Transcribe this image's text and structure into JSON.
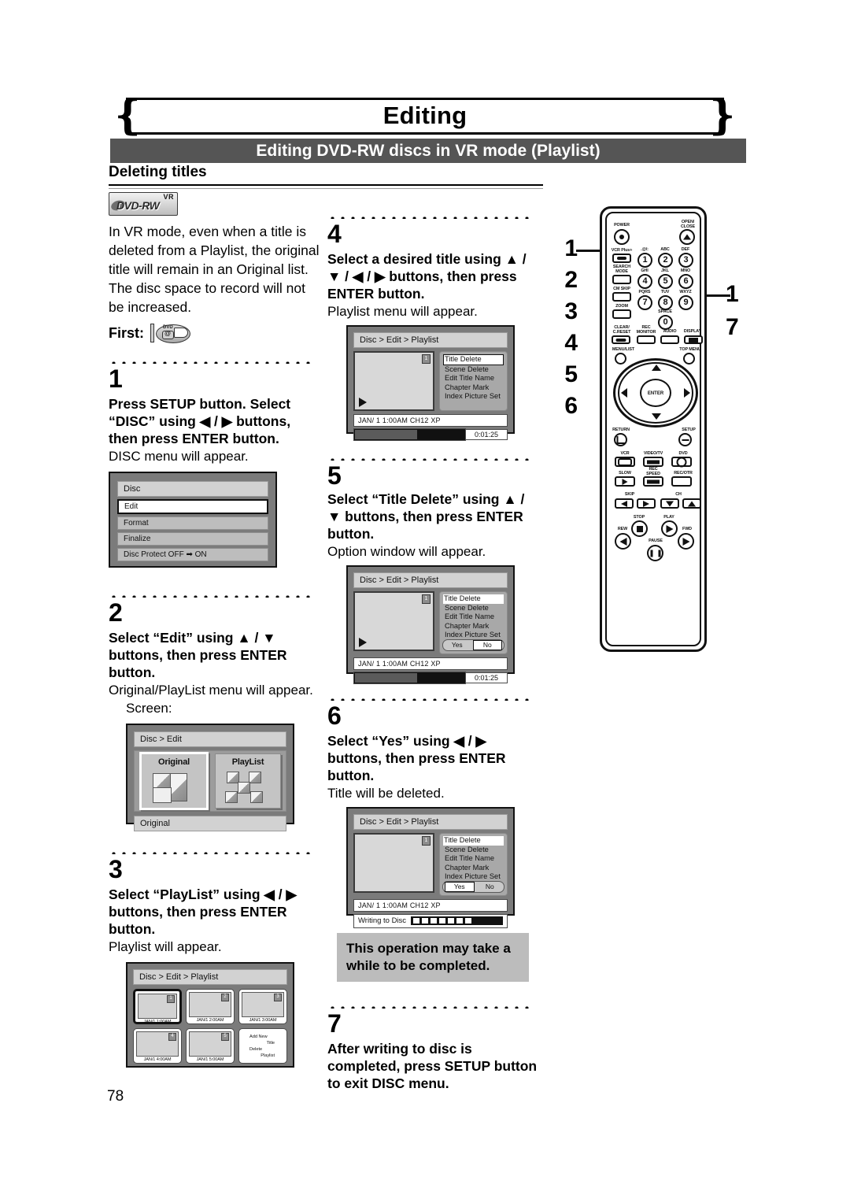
{
  "header": {
    "chapter_title": "Editing",
    "section_title": "Editing DVD-RW discs in VR mode (Playlist)",
    "subsection_title": "Deleting titles"
  },
  "left_column": {
    "badge": {
      "vr": "VR",
      "format": "DVD-RW"
    },
    "intro": "In VR mode, even when a title is deleted from a Playlist, the original title will remain in an Original list. The disc space to record will not be increased.",
    "first_label": "First:",
    "first_icon_label": "DVD",
    "steps": [
      {
        "number": "1",
        "heading": "Press SETUP button. Select “DISC” using ◀ / ▶ buttons, then press ENTER button.",
        "subtext": "DISC menu will appear.",
        "screen": {
          "title": "Disc",
          "items": [
            "Edit",
            "Format",
            "Finalize",
            "Disc Protect OFF ➡ ON"
          ],
          "selected": "Edit"
        }
      },
      {
        "number": "2",
        "heading": "Select “Edit” using ▲ / ▼ buttons, then press ENTER button.",
        "subtext": "Original/PlayList menu will appear.",
        "screen_label": "Screen:",
        "screen": {
          "title": "Disc > Edit",
          "tiles": [
            "Original",
            "PlayList"
          ],
          "selected": "Original",
          "status": "Original"
        }
      },
      {
        "number": "3",
        "heading": "Select “PlayList” using ◀ / ▶ buttons, then press ENTER button.",
        "subtext": "Playlist will appear.",
        "screen": {
          "title": "Disc > Edit > Playlist",
          "cells": [
            {
              "no": "1",
              "caption": "JAN/1  1:00AM",
              "selected": true
            },
            {
              "no": "2",
              "caption": "JAN/1  2:00AM",
              "selected": false
            },
            {
              "no": "3",
              "caption": "JAN/1  3:00AM",
              "selected": false
            },
            {
              "no": "4",
              "caption": "JAN/1  4:00AM",
              "selected": false
            },
            {
              "no": "5",
              "caption": "JAN/1  5:00AM",
              "selected": false
            }
          ],
          "add_new_line1": "Add  New",
          "add_new_line2": "Title",
          "add_new_line3": "Delete",
          "add_new_line4": "Playlist"
        }
      }
    ]
  },
  "mid_column": {
    "steps": [
      {
        "number": "4",
        "heading": "Select a desired title using ▲ / ▼ / ◀ / ▶ buttons, then press ENTER button.",
        "subtext": "Playlist menu will appear.",
        "screen": {
          "title": "Disc > Edit > Playlist",
          "thumb_no": "1",
          "menu": [
            "Title Delete",
            "Scene Delete",
            "Edit Title Name",
            "Chapter Mark",
            "Index Picture Set"
          ],
          "selected": "Title Delete",
          "info": "JAN/ 1  1:00AM  CH12    XP",
          "time": "0:01:25"
        }
      },
      {
        "number": "5",
        "heading": "Select “Title Delete” using ▲ / ▼ buttons, then press ENTER button.",
        "subtext": "Option window will appear.",
        "screen": {
          "title": "Disc > Edit > Playlist",
          "thumb_no": "1",
          "menu": [
            "Title Delete",
            "Scene Delete",
            "Edit Title Name",
            "Chapter Mark",
            "Index Picture Set"
          ],
          "selected": "Title Delete",
          "yes_label": "Yes",
          "no_label": "No",
          "yesno_selected": "No",
          "info": "JAN/ 1  1:00AM  CH12    XP",
          "time": "0:01:25"
        }
      },
      {
        "number": "6",
        "heading": "Select “Yes” using ◀ / ▶ buttons, then press ENTER button.",
        "subtext": "Title will be deleted.",
        "screen": {
          "title": "Disc > Edit > Playlist",
          "thumb_no": "1",
          "menu": [
            "Title Delete",
            "Scene Delete",
            "Edit Title Name",
            "Chapter Mark",
            "Index Picture Set"
          ],
          "selected": "Title Delete",
          "yes_label": "Yes",
          "no_label": "No",
          "yesno_selected": "Yes",
          "info": "JAN/ 1  1:00AM  CH12    XP",
          "writing_label": "Writing to Disc"
        }
      },
      {
        "number": "7",
        "heading": "After writing to disc is completed, press SETUP button to exit DISC menu."
      }
    ],
    "note": "This operation may take a while to be completed."
  },
  "remote": {
    "callouts_left": [
      "1",
      "2",
      "3",
      "4",
      "5",
      "6"
    ],
    "callouts_right": [
      "1",
      "7"
    ],
    "labels": {
      "power": "POWER",
      "open_close": "OPEN/\nCLOSE",
      "vcr_plus": "VCR Plus+",
      "search_mode": "SEARCH\nMODE",
      "cm_skip": "CM SKIP",
      "zoom": "ZOOM",
      "clear_reset": "CLEAR/\nC.RESET",
      "rec_monitor": "REC\nMONITOR",
      "audio": "AUDIO",
      "display": "DISPLAY",
      "menu_list": "MENU/LIST",
      "top_menu": "TOP MENU",
      "enter": "ENTER",
      "return": "RETURN",
      "setup": "SETUP",
      "vcr": "VCR",
      "video_tv": "VIDEO/TV",
      "dvd": "DVD",
      "slow": "SLOW",
      "rec_speed": "REC\nSPEED",
      "rec_otr": "REC/OTR",
      "skip": "SKIP",
      "ch": "CH",
      "stop": "STOP",
      "play": "PLAY",
      "rew": "REW",
      "fwd": "FWD",
      "pause": "PAUSE"
    },
    "keypad": [
      {
        "digit": "1",
        "letters": ".@/:"
      },
      {
        "digit": "2",
        "letters": "ABC"
      },
      {
        "digit": "3",
        "letters": "DEF"
      },
      {
        "digit": "4",
        "letters": "GHI"
      },
      {
        "digit": "5",
        "letters": "JKL"
      },
      {
        "digit": "6",
        "letters": "MNO"
      },
      {
        "digit": "7",
        "letters": "PQRS"
      },
      {
        "digit": "8",
        "letters": "TUV"
      },
      {
        "digit": "9",
        "letters": "WXYZ"
      },
      {
        "digit": "0",
        "letters": "SPACE"
      }
    ]
  },
  "footer": {
    "page_number": "78"
  }
}
